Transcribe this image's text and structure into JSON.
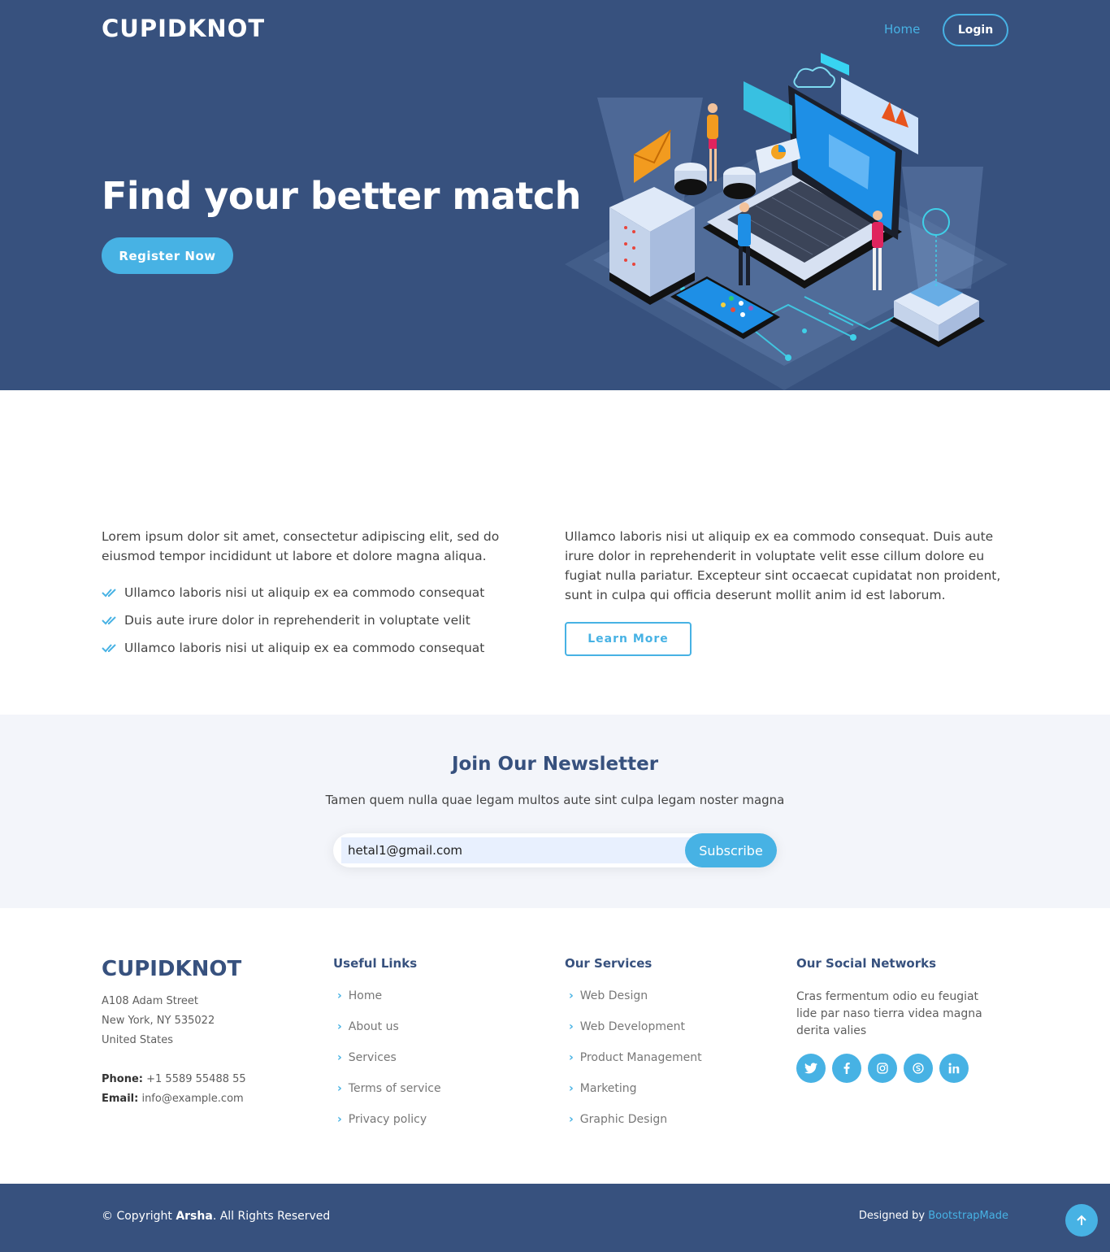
{
  "header": {
    "logo": "CUPIDKNOT",
    "nav": {
      "home": "Home",
      "login": "Login"
    }
  },
  "hero": {
    "title": "Find your better match",
    "cta": "Register Now",
    "illustration": "isometric-laptop-servers-illustration"
  },
  "about": {
    "left_paragraph": "Lorem ipsum dolor sit amet, consectetur adipiscing elit, sed do eiusmod tempor incididunt ut labore et dolore magna aliqua.",
    "list": [
      "Ullamco laboris nisi ut aliquip ex ea commodo consequat",
      "Duis aute irure dolor in reprehenderit in voluptate velit",
      "Ullamco laboris nisi ut aliquip ex ea commodo consequat"
    ],
    "right_paragraph": "Ullamco laboris nisi ut aliquip ex ea commodo consequat. Duis aute irure dolor in reprehenderit in voluptate velit esse cillum dolore eu fugiat nulla pariatur. Excepteur sint occaecat cupidatat non proident, sunt in culpa qui officia deserunt mollit anim id est laborum.",
    "learn_more": "Learn More"
  },
  "newsletter": {
    "title": "Join Our Newsletter",
    "subtitle": "Tamen quem nulla quae legam multos aute sint culpa legam noster magna",
    "email_value": "hetal1@gmail.com",
    "subscribe": "Subscribe"
  },
  "footer": {
    "logo": "CUPIDKNOT",
    "address": [
      "A108 Adam Street",
      "New York, NY 535022",
      "United States"
    ],
    "phone_label": "Phone:",
    "phone": "+1 5589 55488 55",
    "email_label": "Email:",
    "email": "info@example.com",
    "useful_links": {
      "title": "Useful Links",
      "items": [
        "Home",
        "About us",
        "Services",
        "Terms of service",
        "Privacy policy"
      ]
    },
    "services": {
      "title": "Our Services",
      "items": [
        "Web Design",
        "Web Development",
        "Product Management",
        "Marketing",
        "Graphic Design"
      ]
    },
    "social": {
      "title": "Our Social Networks",
      "text": "Cras fermentum odio eu feugiat lide par naso tierra videa magna derita valies",
      "icons": [
        "twitter-icon",
        "facebook-icon",
        "instagram-icon",
        "skype-icon",
        "linkedin-icon"
      ]
    }
  },
  "bottom": {
    "copyright_prefix": "© Copyright",
    "copyright_brand": "Arsha",
    "copyright_suffix": ". All Rights Reserved",
    "designed_prefix": "Designed by",
    "designed_link": "BootstrapMade"
  },
  "colors": {
    "primary_dark": "#37517e",
    "accent": "#47b2e4",
    "section_bg": "#f3f5fa"
  }
}
